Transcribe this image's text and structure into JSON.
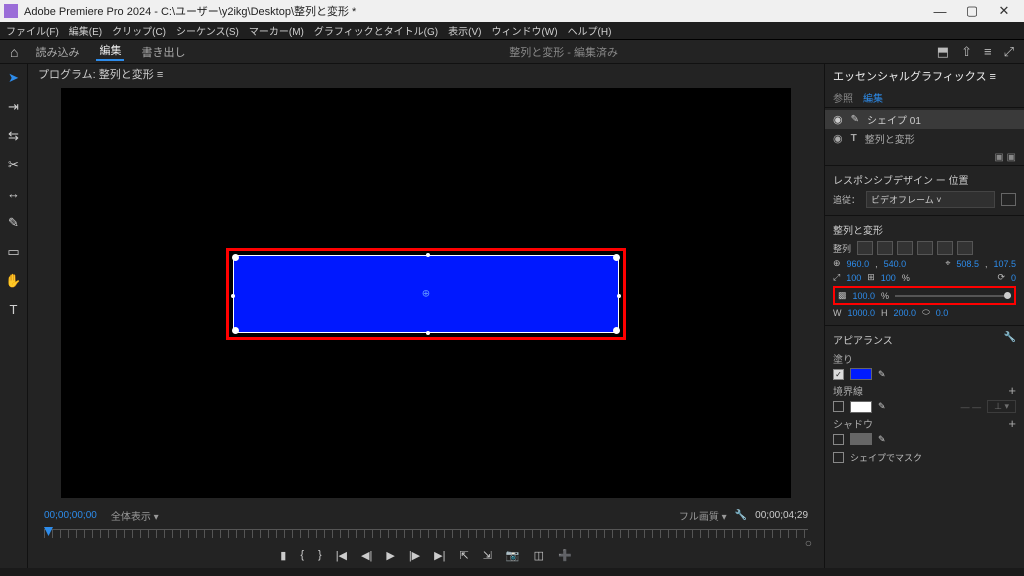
{
  "titlebar": {
    "title": "Adobe Premiere Pro 2024 - C:\\ユーザー\\y2ikg\\Desktop\\整列と変形 *"
  },
  "menubar": [
    "ファイル(F)",
    "編集(E)",
    "クリップ(C)",
    "シーケンス(S)",
    "マーカー(M)",
    "グラフィックとタイトル(G)",
    "表示(V)",
    "ウィンドウ(W)",
    "ヘルプ(H)"
  ],
  "workspacebar": {
    "tabs": [
      {
        "label": "読み込み",
        "active": false
      },
      {
        "label": "編集",
        "active": true
      },
      {
        "label": "書き出し",
        "active": false
      }
    ],
    "doc_title": "整列と変形 - 編集済み"
  },
  "program_panel_title": "プログラム: 整列と変形 ≡",
  "timebar": {
    "timecode_left": "00;00;00;00",
    "fit": "全体表示",
    "quality": "フル画質",
    "timecode_right": "00;00;04;29"
  },
  "right": {
    "panel_title": "エッセンシャルグラフィックス ≡",
    "tabs": {
      "browse": "参照",
      "edit": "編集"
    },
    "layers": [
      {
        "name": "シェイプ 01",
        "icon": "pen",
        "selected": true
      },
      {
        "name": "整列と変形",
        "icon": "T",
        "selected": false
      }
    ],
    "responsive_label": "レスポンシブデザイン ー 位置",
    "track_label": "追従：",
    "track_value": "ビデオフレーム",
    "align_section": "整列と変形",
    "align_label": "整列",
    "pos": {
      "x": "960.0",
      "y": "540.0"
    },
    "anchor": {
      "x": "508.5",
      "y": "107.5"
    },
    "scale": {
      "v": "100",
      "link": "⊞",
      "pct": "100",
      "unit": "%"
    },
    "rotate": "0",
    "opacity": {
      "value": "100.0",
      "unit": "%"
    },
    "size": {
      "W": "W",
      "wval": "1000.0",
      "H": "H",
      "hval": "200.0",
      "corner": "⬭",
      "cval": "0.0"
    },
    "appearance": "アピアランス",
    "fill": "塗り",
    "stroke": "境界線",
    "shadow": "シャドウ",
    "mask": "シェイプでマスク"
  }
}
